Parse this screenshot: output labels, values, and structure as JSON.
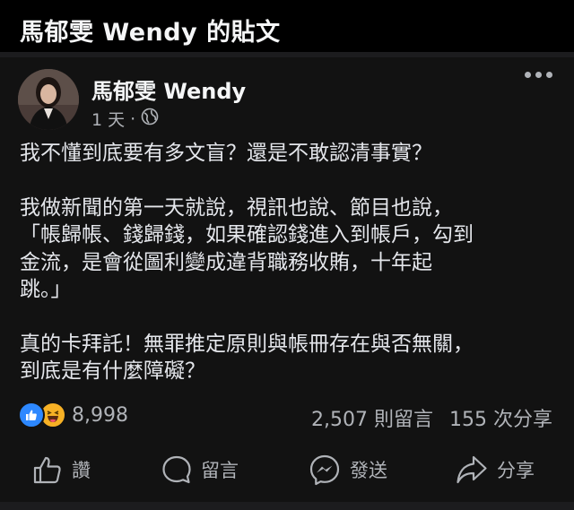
{
  "page": {
    "title": "馬郁雯 Wendy 的貼文"
  },
  "post": {
    "author": "馬郁雯 Wendy",
    "time": "1 天",
    "separator": "·",
    "paragraphs": [
      [
        "我不懂到底要有多文盲？還是不敢認清事實？"
      ],
      [
        "我做新聞的第一天就說，視訊也說、節目也說，",
        "「帳歸帳、錢歸錢，如果確認錢進入到帳戶，勾到",
        "金流，是會從圖利變成違背職務收賄，十年起",
        "跳。」"
      ],
      [
        "真的卡拜託！無罪推定原則與帳冊存在與否無關，",
        "到底是有什麼障礙？"
      ]
    ],
    "reactions_count": "8,998",
    "comments": "2,507 則留言",
    "shares": "155 次分享"
  },
  "actions": {
    "like": "讚",
    "comment": "留言",
    "send": "發送",
    "share": "分享"
  },
  "colors": {
    "background": "#000000",
    "card": "#121212",
    "text": "#e4e6eb",
    "secondary": "#b0b3b8",
    "like_blue": "#2d88ff",
    "haha_yellow": "#f7b125"
  },
  "icons": [
    "globe-icon",
    "more-icon",
    "like-reaction-icon",
    "haha-reaction-icon",
    "thumbs-up-icon",
    "comment-icon",
    "messenger-icon",
    "share-icon"
  ]
}
